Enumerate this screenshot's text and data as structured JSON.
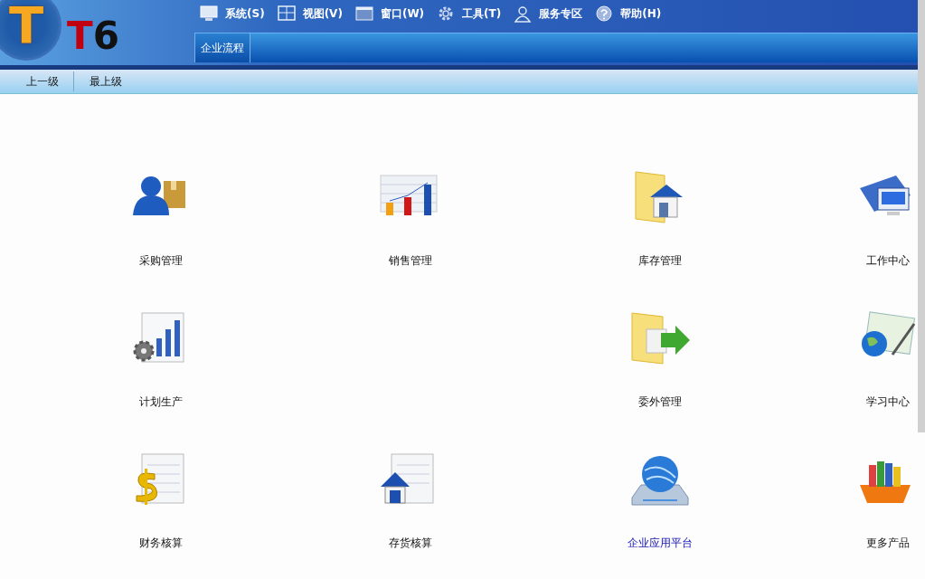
{
  "logo": {
    "letter": "T",
    "product_t": "T",
    "product_6": "6"
  },
  "menu": [
    {
      "kind": "monitor",
      "label": "系统(S)"
    },
    {
      "kind": "grid",
      "label": "视图(V)"
    },
    {
      "kind": "window",
      "label": "窗口(W)"
    },
    {
      "kind": "gear",
      "label": "工具(T)"
    },
    {
      "kind": "person",
      "label": "服务专区"
    },
    {
      "kind": "help",
      "label": "帮助(H)"
    }
  ],
  "tabs": [
    {
      "label": "企业流程",
      "selected": true
    }
  ],
  "toolbar": [
    "上一级",
    "最上级"
  ],
  "modules": [
    {
      "kind": "purchase",
      "label": "采购管理",
      "highlighted": false
    },
    {
      "kind": "sales",
      "label": "销售管理",
      "highlighted": false
    },
    {
      "kind": "inventory",
      "label": "库存管理",
      "highlighted": false
    },
    {
      "kind": "workcenter",
      "label": "工作中心",
      "highlighted": false
    },
    {
      "kind": "planning",
      "label": "计划生产",
      "highlighted": false
    },
    {
      "kind": "empty"
    },
    {
      "kind": "outsourcing",
      "label": "委外管理",
      "highlighted": false
    },
    {
      "kind": "learning",
      "label": "学习中心",
      "highlighted": false
    },
    {
      "kind": "finance",
      "label": "财务核算",
      "highlighted": false
    },
    {
      "kind": "stock",
      "label": "存货核算",
      "highlighted": false
    },
    {
      "kind": "platform",
      "label": "企业应用平台",
      "highlighted": true
    },
    {
      "kind": "more",
      "label": "更多产品",
      "highlighted": false
    }
  ]
}
